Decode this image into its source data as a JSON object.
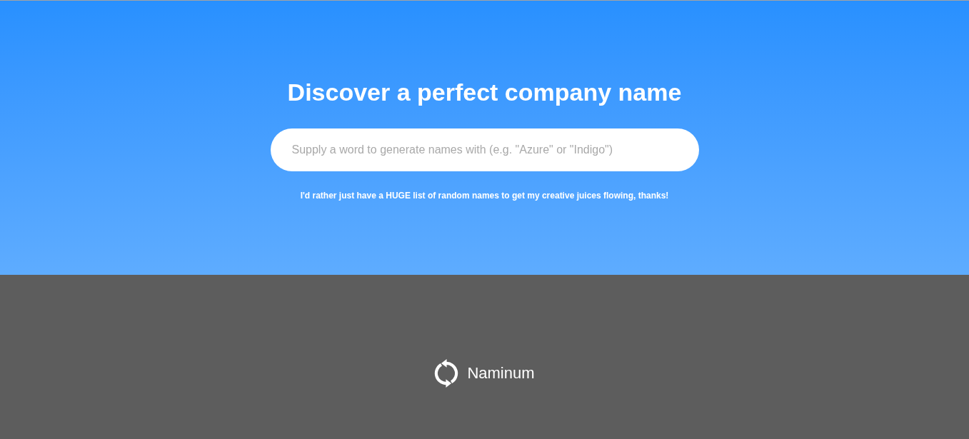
{
  "hero": {
    "title": "Discover a perfect company name",
    "word_field": {
      "placeholder": "Supply a word to generate names with (e.g. \"Azure\" or \"Indigo\")"
    },
    "random_link": "I'd rather just have a HUGE list of random names to get my creative juices flowing, thanks!"
  },
  "footer": {
    "brand": "Naminum"
  }
}
